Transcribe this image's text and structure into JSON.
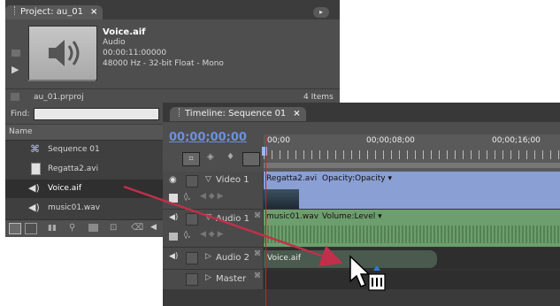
{
  "project": {
    "tab_title": "Project: au_01",
    "clip_name": "Voice.aif",
    "clip_type": "Audio",
    "clip_duration": "00:00:11:00000",
    "clip_format": "48000 Hz - 32-bit Float - Mono",
    "project_file": "au_01.prproj",
    "item_count": "4 Items",
    "find_label": "Find:",
    "column_name": "Name",
    "items": [
      {
        "label": "Sequence 01",
        "icon": "sequence-icon"
      },
      {
        "label": "Regatta2.avi",
        "icon": "video-file-icon"
      },
      {
        "label": "Voice.aif",
        "icon": "audio-file-icon"
      },
      {
        "label": "music01.wav",
        "icon": "audio-file-icon"
      }
    ]
  },
  "timeline": {
    "tab_title": "Timeline: Sequence 01",
    "timecode": "00;00;00;00",
    "ruler": [
      "00;00",
      "00;00;08;00",
      "00;00;16;00"
    ],
    "tracks": {
      "video1": "Video 1",
      "audio1": "Audio 1",
      "audio2": "Audio 2",
      "master": "Master"
    },
    "clips": {
      "video": "Regatta2.avi",
      "video_fx": "Opacity:Opacity",
      "music": "music01.wav",
      "music_fx": "Volume:Level",
      "voice": "Voice.aif"
    }
  },
  "colors": {
    "accent_timecode": "#6f8fe0",
    "playhead": "#d02020",
    "video_clip": "#8a9fd4",
    "audio_clip": "#6d9e6d"
  }
}
